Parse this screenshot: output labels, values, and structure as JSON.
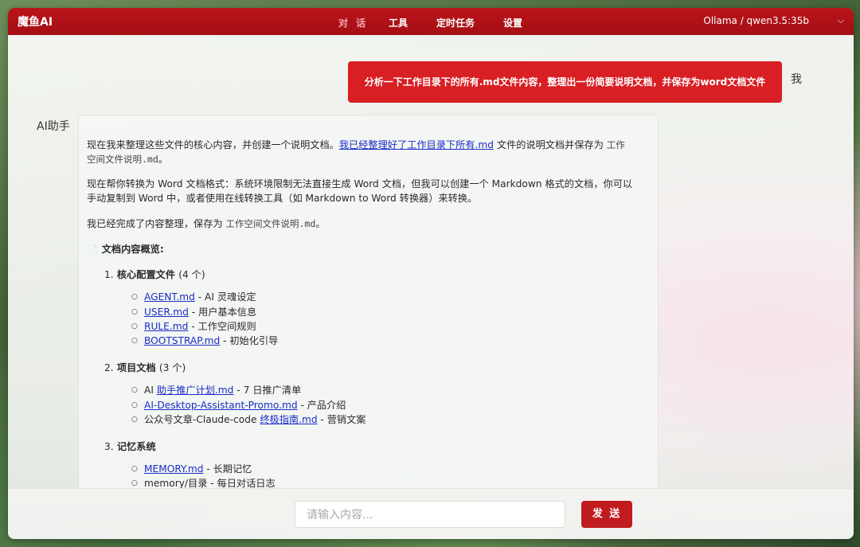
{
  "app": {
    "brand": "魔鱼AI",
    "model": "Ollama / qwen3.5:35b"
  },
  "nav": [
    "对 话",
    "工具",
    "定时任务",
    "设置"
  ],
  "user": {
    "label": "我",
    "message": "分析一下工作目录下的所有.md文件内容，整理出一份简要说明文档，并保存为word文档文件"
  },
  "ai": {
    "label": "AI助手",
    "p1a": "现在我来整理这些文件的核心内容，并创建一个说明文档。",
    "p1link": "我已经整理好了工作目录下所有.md",
    "p1b": " 文件的说明文档并保存为",
    "p1c_line1": "工作",
    "p1c_line2": "空间文件说明.md",
    "p1d": "。",
    "p2_line1": "现在帮你转换为 Word 文档格式：系统环境限制无法直接生成 Word 文档，但我可以创建一个 Markdown 格式的文档，你可以",
    "p2_line2": "手动复制到 Word 中，或者使用在线转换工具（如 Markdown to Word 转换器）来转换。",
    "p3a": "我已经完成了内容整理，保存为",
    "p3b": "工作空间文件说明.md",
    "p3c": "。",
    "overview_icon": "📄",
    "overview": "文档内容概览:",
    "sections": [
      {
        "num": "1.",
        "title": "核心配置文件",
        "count": "(4 个)"
      },
      {
        "num": "2.",
        "title": "项目文档",
        "count": "(3 个)"
      },
      {
        "num": "3.",
        "title": "记忆系统",
        "count": ""
      }
    ],
    "s1": [
      {
        "link": "AGENT.md",
        "desc": " - AI 灵魂设定"
      },
      {
        "link": "USER.md",
        "desc": " - 用户基本信息"
      },
      {
        "link": "RULE.md",
        "desc": " - 工作空间规则"
      },
      {
        "link": "BOOTSTRAP.md",
        "desc": " - 初始化引导"
      }
    ],
    "s2": [
      {
        "pre": "AI ",
        "link": "助手推广计划.md",
        "desc": " - 7 日推广清单"
      },
      {
        "pre": "",
        "link": "AI-Desktop-Assistant-Promo.md",
        "desc": " - 产品介绍"
      },
      {
        "pre": "公众号文章-Claude-code ",
        "link": "终极指南.md",
        "desc": " - 营销文案"
      }
    ],
    "s3": [
      {
        "link": "MEMORY.md",
        "desc": " - 长期记忆"
      },
      {
        "text": "memory/目录 - 每日对话日志"
      }
    ]
  },
  "composer": {
    "placeholder": "请输入内容...",
    "send": "发 送"
  }
}
